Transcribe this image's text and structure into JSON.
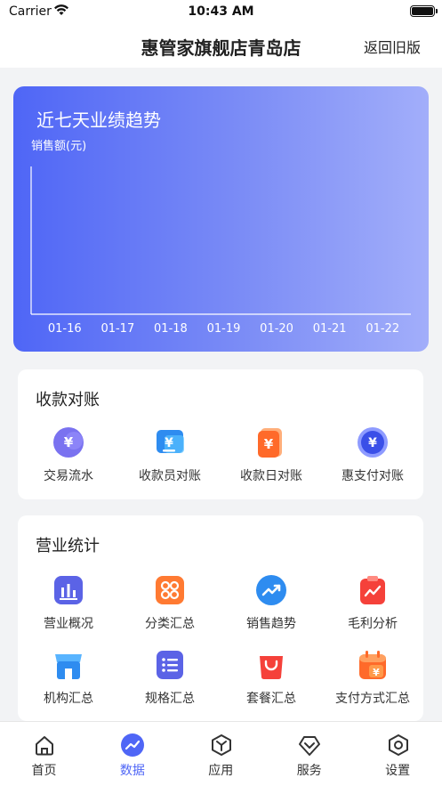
{
  "status_bar": {
    "carrier": "Carrier",
    "time": "10:43 AM"
  },
  "nav": {
    "title": "惠管家旗舰店青岛店",
    "right_action": "返回旧版"
  },
  "trend_card": {
    "title": "近七天业绩趋势",
    "ylabel": "销售额(元)"
  },
  "chart_data": {
    "type": "line",
    "title": "近七天业绩趋势",
    "ylabel": "销售额(元)",
    "xlabel": "",
    "categories": [
      "01-16",
      "01-17",
      "01-18",
      "01-19",
      "01-20",
      "01-21",
      "01-22"
    ],
    "series": [
      {
        "values": []
      }
    ],
    "grid": false
  },
  "collection": {
    "title": "收款对账",
    "items": [
      {
        "label": "交易流水",
        "icon": "yen-bubble-icon",
        "color": "#7a72f0"
      },
      {
        "label": "收款员对账",
        "icon": "cashier-receipt-icon",
        "color": "#2e8cf0"
      },
      {
        "label": "收款日对账",
        "icon": "daily-receipt-icon",
        "color": "#ff6a2a"
      },
      {
        "label": "惠支付对账",
        "icon": "hui-pay-icon",
        "color": "#3a4fe8"
      }
    ]
  },
  "business": {
    "title": "营业统计",
    "items": [
      {
        "label": "营业概况",
        "icon": "business-overview-icon",
        "color": "#5b63e6"
      },
      {
        "label": "分类汇总",
        "icon": "category-summary-icon",
        "color": "#ff7a32"
      },
      {
        "label": "销售趋势",
        "icon": "sales-trend-icon",
        "color": "#2e8cf0"
      },
      {
        "label": "毛利分析",
        "icon": "gross-profit-icon",
        "color": "#f5413a"
      },
      {
        "label": "机构汇总",
        "icon": "store-summary-icon",
        "color": "#2e8cf0"
      },
      {
        "label": "规格汇总",
        "icon": "spec-summary-icon",
        "color": "#5b63e6"
      },
      {
        "label": "套餐汇总",
        "icon": "package-summary-icon",
        "color": "#f5413a"
      },
      {
        "label": "支付方式汇总",
        "icon": "payment-method-icon",
        "color": "#ff6a2a"
      }
    ]
  },
  "tabs": [
    {
      "label": "首页",
      "icon": "home-icon",
      "active": false
    },
    {
      "label": "数据",
      "icon": "data-icon",
      "active": true
    },
    {
      "label": "应用",
      "icon": "apps-icon",
      "active": false
    },
    {
      "label": "服务",
      "icon": "service-icon",
      "active": false
    },
    {
      "label": "设置",
      "icon": "settings-icon",
      "active": false
    }
  ],
  "colors": {
    "accent": "#4f66f6",
    "gradient_end": "#a2aefa",
    "inactive_tab": "#333333"
  }
}
